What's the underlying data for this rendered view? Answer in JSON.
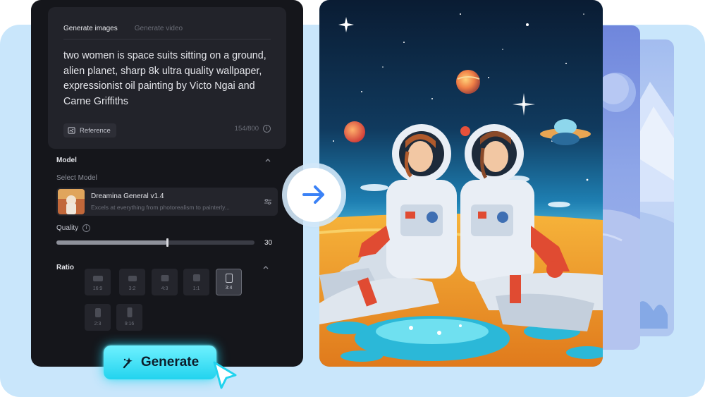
{
  "prompt_card": {
    "tabs": [
      {
        "label": "Generate images",
        "active": true
      },
      {
        "label": "Generate video",
        "active": false
      }
    ],
    "prompt": "two women is space suits sitting on a ground, alien planet, sharp 8k ultra quality wallpaper, expressionist oil painting by Victo Ngai and Carne Griffiths",
    "reference_label": "Reference",
    "char_count": "154/800"
  },
  "model": {
    "section_title": "Model",
    "select_label": "Select Model",
    "name": "Dreamina General v1.4",
    "description": "Excels at everything from photorealism to painterly..."
  },
  "quality": {
    "label": "Quality",
    "value": "30",
    "fill_fraction": 0.56
  },
  "ratio": {
    "section_title": "Ratio",
    "options": [
      {
        "label": "16:9",
        "active": false
      },
      {
        "label": "3:2",
        "active": false
      },
      {
        "label": "4:3",
        "active": false
      },
      {
        "label": "1:1",
        "active": false
      },
      {
        "label": "3:4",
        "active": true
      },
      {
        "label": "2:3",
        "active": false
      },
      {
        "label": "9:16",
        "active": false
      }
    ]
  },
  "generate": {
    "label": "Generate"
  },
  "icons": {
    "arrow": "arrow-right-icon",
    "generate": "sparkle-wand-icon",
    "reference": "image-reference-icon",
    "info": "info-icon",
    "settings": "sliders-icon",
    "collapse": "chevron-up-icon",
    "pointer": "cursor-pointer-icon"
  },
  "colors": {
    "accent": "#22d3ee",
    "arrow": "#3b82f6",
    "panel": "#15161b",
    "backdrop": "#c9e6fb"
  }
}
